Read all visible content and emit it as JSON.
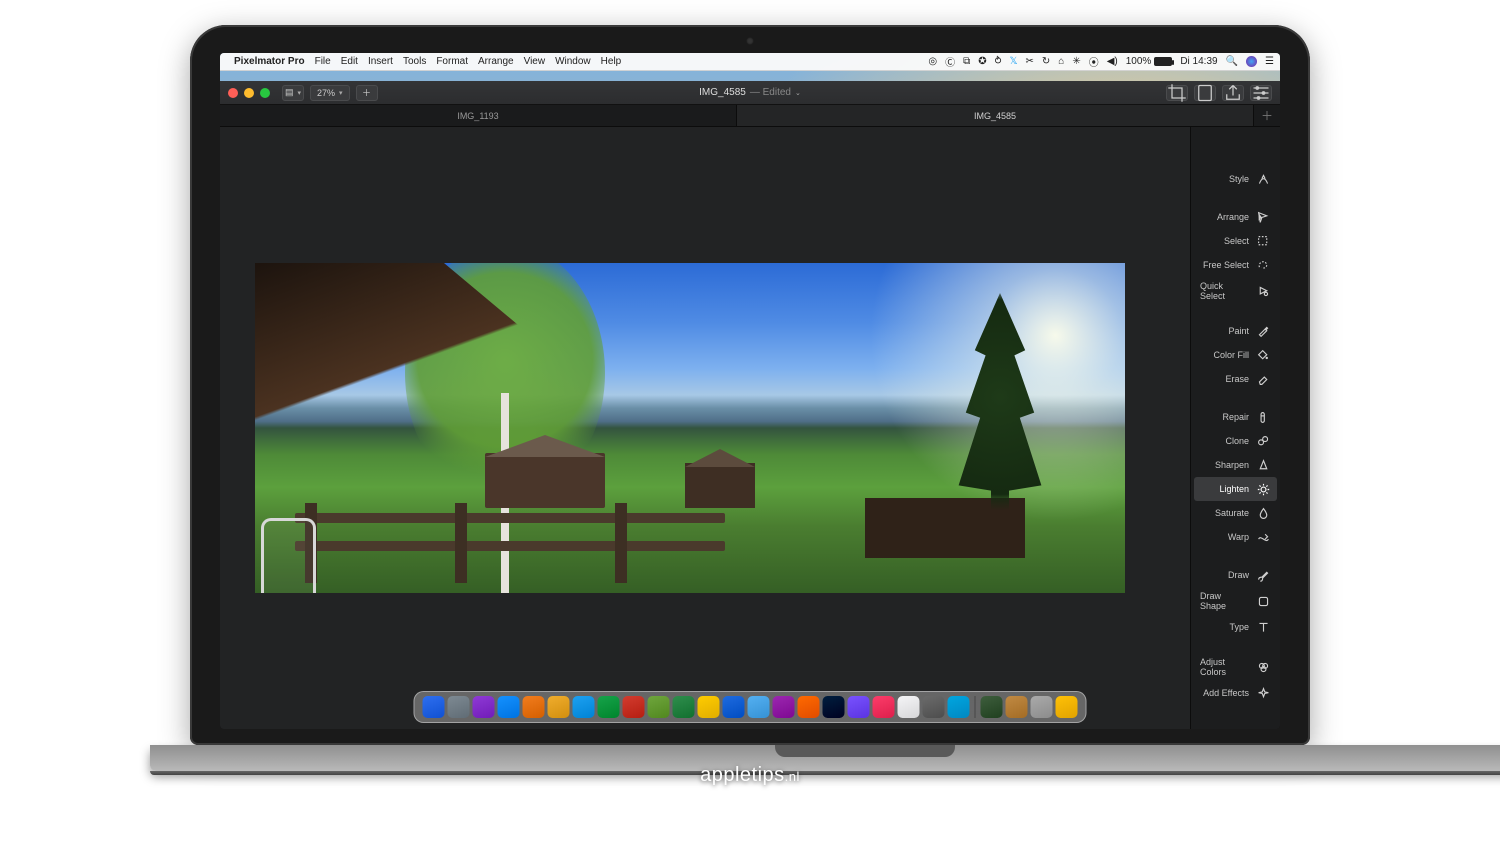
{
  "menubar": {
    "app_name": "Pixelmator Pro",
    "items": [
      "File",
      "Edit",
      "Insert",
      "Tools",
      "Format",
      "Arrange",
      "View",
      "Window",
      "Help"
    ],
    "battery_percent": "100%",
    "clock": "Di 14:39"
  },
  "window": {
    "zoom": "27%",
    "title": "IMG_4585",
    "edited_suffix": "— Edited",
    "tabs": [
      "IMG_1193",
      "IMG_4585"
    ],
    "active_tab_index": 1
  },
  "tools": {
    "groups": [
      [
        {
          "id": "style",
          "label": "Style"
        }
      ],
      [
        {
          "id": "arrange",
          "label": "Arrange"
        },
        {
          "id": "select",
          "label": "Select"
        },
        {
          "id": "free-select",
          "label": "Free Select"
        },
        {
          "id": "quick-select",
          "label": "Quick Select"
        }
      ],
      [
        {
          "id": "paint",
          "label": "Paint"
        },
        {
          "id": "color-fill",
          "label": "Color Fill"
        },
        {
          "id": "erase",
          "label": "Erase"
        }
      ],
      [
        {
          "id": "repair",
          "label": "Repair"
        },
        {
          "id": "clone",
          "label": "Clone"
        },
        {
          "id": "sharpen",
          "label": "Sharpen"
        },
        {
          "id": "lighten",
          "label": "Lighten"
        },
        {
          "id": "saturate",
          "label": "Saturate"
        },
        {
          "id": "warp",
          "label": "Warp"
        }
      ],
      [
        {
          "id": "draw",
          "label": "Draw"
        },
        {
          "id": "draw-shape",
          "label": "Draw Shape"
        },
        {
          "id": "type",
          "label": "Type"
        }
      ],
      [
        {
          "id": "adjust-colors",
          "label": "Adjust Colors"
        },
        {
          "id": "add-effects",
          "label": "Add Effects"
        }
      ]
    ],
    "selected_id": "lighten"
  },
  "dock_colors": [
    "#2e6ff0",
    "#7e8a93",
    "#8f3ad6",
    "#1491ff",
    "#f27d1e",
    "#f0ad2d",
    "#1da1f2",
    "#16a34a",
    "#d33c2f",
    "#6fa63d",
    "#2f8e4d",
    "#ffcc00",
    "#1e6be0",
    "#54b0f2",
    "#9c27b0",
    "#ff6a00",
    "#001f3f",
    "#7952ff",
    "#fc3d6a",
    "#f5f5f7",
    "#6b6b6b",
    "#00a6e0",
    "#3e5e3d",
    "#c18a43",
    "#aaaaaa",
    "#ffc107"
  ],
  "brand": {
    "name": "appletips",
    "tld": ".nl"
  }
}
